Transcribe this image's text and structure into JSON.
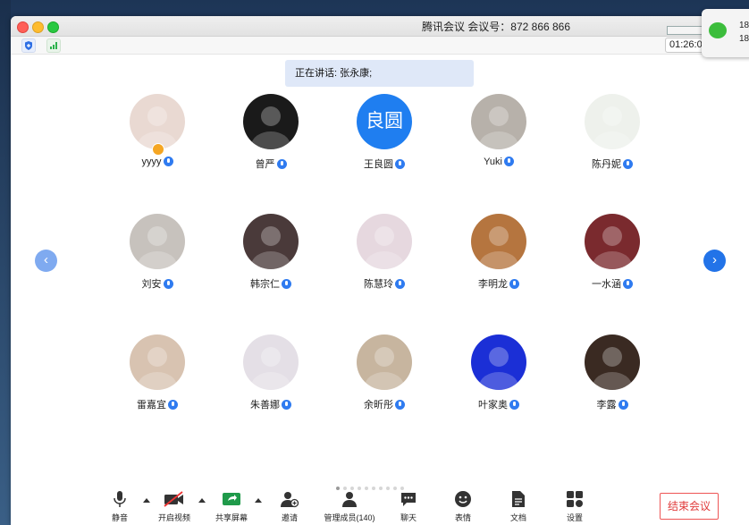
{
  "window": {
    "title": "腾讯会议 会议号：872 866 866",
    "timer": "01:26:0"
  },
  "notification": {
    "line1": "18",
    "line2": "18"
  },
  "speaker_banner": "正在讲话: 张永康;",
  "participants": [
    {
      "name": "yyyy",
      "avatar_color": "#e9d9d2",
      "is_host": true
    },
    {
      "name": "曾严",
      "avatar_color": "#1a1a1a"
    },
    {
      "name": "王良圆",
      "avatar_text": "良圆",
      "avatar_color": "#1f7ef0"
    },
    {
      "name": "Yuki",
      "avatar_color": "#b7b1aa"
    },
    {
      "name": "陈丹妮",
      "avatar_color": "#eef1ec"
    },
    {
      "name": "刘安",
      "avatar_color": "#c7c2bd"
    },
    {
      "name": "韩宗仁",
      "avatar_color": "#4a3a3a"
    },
    {
      "name": "陈慧玲",
      "avatar_color": "#e6d8df"
    },
    {
      "name": "李明龙",
      "avatar_color": "#b5753f"
    },
    {
      "name": "一水涵",
      "avatar_color": "#7a2a2e"
    },
    {
      "name": "雷嘉宜",
      "avatar_color": "#d8c3b1"
    },
    {
      "name": "朱善娜",
      "avatar_color": "#e4dfe6"
    },
    {
      "name": "余昕彤",
      "avatar_color": "#c7b59f"
    },
    {
      "name": "叶家奥",
      "avatar_color": "#1b2fd6"
    },
    {
      "name": "李露",
      "avatar_color": "#3a2a22"
    }
  ],
  "toolbar": {
    "mute": "静音",
    "video": "开启视频",
    "share": "共享屏幕",
    "invite": "邀请",
    "members": "管理成员(140)",
    "chat": "聊天",
    "emoji": "表情",
    "docs": "文档",
    "settings": "设置",
    "end": "结束会议"
  },
  "pagination": {
    "pages": 10,
    "current": 1
  },
  "icons": [
    "shield-icon",
    "signal-icon",
    "prev-page-icon",
    "next-page-icon",
    "microphone-icon",
    "video-off-icon",
    "share-screen-icon",
    "invite-icon",
    "members-icon",
    "chat-icon",
    "emoji-icon",
    "document-icon",
    "settings-icon",
    "wechat-icon"
  ]
}
